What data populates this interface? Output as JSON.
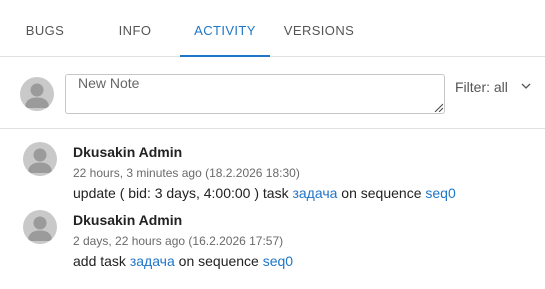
{
  "tabs": [
    {
      "label": "BUGS"
    },
    {
      "label": "INFO"
    },
    {
      "label": "ACTIVITY"
    },
    {
      "label": "VERSIONS"
    }
  ],
  "active_tab": "ACTIVITY",
  "note": {
    "placeholder": "New Note",
    "value": ""
  },
  "filter": {
    "label": "Filter: all",
    "icon": "chevron-down-icon"
  },
  "activities": [
    {
      "author": "Dkusakin Admin",
      "time": "22 hours, 3 minutes ago (18.2.2026 18:30)",
      "prefix": "update ( bid: 3 days, 4:00:00 ) task ",
      "task_link": "задача",
      "middle": " on sequence ",
      "sequence_link": "seq0"
    },
    {
      "author": "Dkusakin Admin",
      "time": "2 days, 22 hours ago (16.2.2026 17:57)",
      "prefix": "add task ",
      "task_link": "задача",
      "middle": " on sequence ",
      "sequence_link": "seq0"
    }
  ],
  "colors": {
    "accent": "#1e76c8",
    "avatar": "#c9c9c9",
    "divider": "#e2e2e2"
  }
}
